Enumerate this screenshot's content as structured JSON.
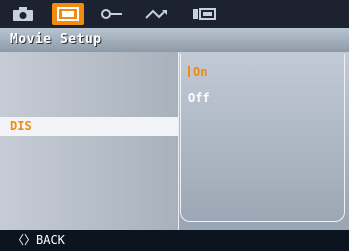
{
  "toolbar": {
    "tabs": [
      {
        "icon": "camera-icon",
        "active": false
      },
      {
        "icon": "movie-setup-icon",
        "active": true
      },
      {
        "icon": "playback-key-icon",
        "active": false
      },
      {
        "icon": "wave-icon",
        "active": false
      },
      {
        "icon": "settings-icon",
        "active": false
      }
    ],
    "active_color": "#f08a10"
  },
  "title": "Movie Setup",
  "menu": {
    "selected_item": "DIS"
  },
  "options": {
    "on": "On",
    "off": "Off"
  },
  "footer": {
    "back": "〈〉BACK"
  }
}
